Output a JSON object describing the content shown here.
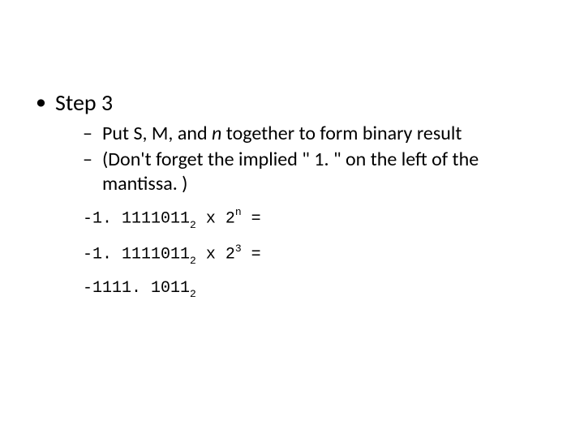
{
  "level1": {
    "step_label": "Step 3"
  },
  "level2": {
    "line1_a": "Put S, M, and ",
    "line1_n": "n",
    "line1_b": " together to form binary result",
    "line2": "(Don't forget the implied \" 1. \" on the left of the mantissa. )"
  },
  "code": {
    "l1": {
      "a": "-1. 1111011",
      "sub": "2",
      "b": " x  2",
      "sup": "n",
      "c": " ="
    },
    "l2": {
      "a": "-1. 1111011",
      "sub": "2",
      "b": " x  2",
      "sup": "3",
      "c": " ="
    },
    "l3": {
      "a": "-1111. 1011",
      "sub": "2"
    }
  }
}
